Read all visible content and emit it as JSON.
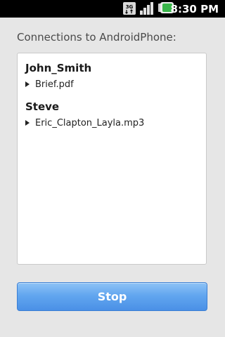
{
  "status_bar": {
    "network_label": "3G",
    "time": "8:30 PM",
    "icons": [
      "network-3g-icon",
      "signal-strength-icon",
      "battery-icon"
    ]
  },
  "heading": "Connections to AndroidPhone:",
  "connections": [
    {
      "name": "John_Smith",
      "file": "Brief.pdf"
    },
    {
      "name": "Steve",
      "file": "Eric_Clapton_Layla.mp3"
    }
  ],
  "stop_button_label": "Stop",
  "colors": {
    "background": "#e6e6e6",
    "panel": "#ffffff",
    "button_blue": "#5aa0ee",
    "battery_green": "#39b54a"
  }
}
